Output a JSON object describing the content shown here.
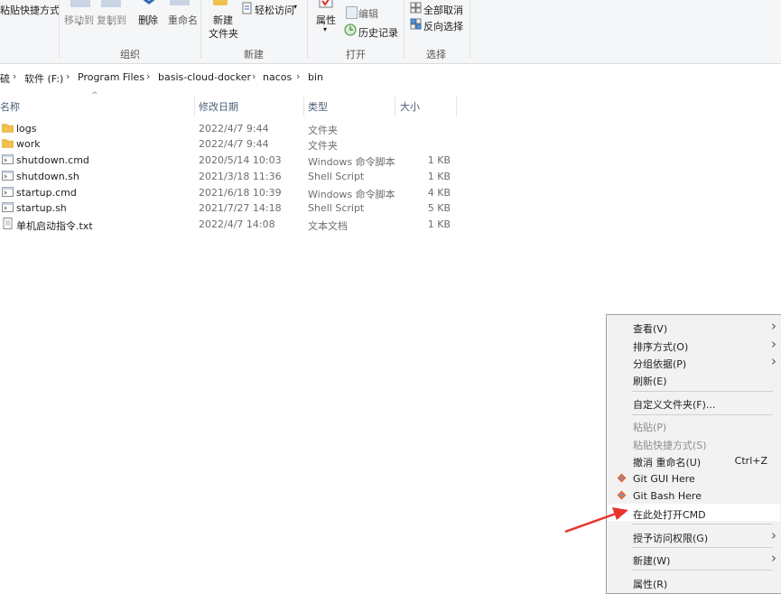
{
  "ribbon": {
    "paste_shortcut": "粘贴快捷方式",
    "move_to": "移动到",
    "copy_to": "复制到",
    "delete": "删除",
    "rename": "重命名",
    "new_folder_1": "新建",
    "new_folder_2": "文件夹",
    "easy_access": "轻松访问",
    "properties": "属性",
    "edit": "编辑",
    "history": "历史记录",
    "select_all": "全部取消",
    "invert": "反向选择",
    "groups": {
      "organize": "组织",
      "new": "新建",
      "open": "打开",
      "select": "选择"
    }
  },
  "breadcrumb": [
    "硫",
    "软件 (F:)",
    "Program Files",
    "basis-cloud-docker",
    "nacos",
    "bin"
  ],
  "columns": {
    "name": "名称",
    "modified": "修改日期",
    "type": "类型",
    "size": "大小"
  },
  "files": [
    {
      "name": "logs",
      "date": "2022/4/7 9:44",
      "type": "文件夹",
      "size": "",
      "icon": "folder-icon"
    },
    {
      "name": "work",
      "date": "2022/4/7 9:44",
      "type": "文件夹",
      "size": "",
      "icon": "folder-icon"
    },
    {
      "name": "shutdown.cmd",
      "date": "2020/5/14 10:03",
      "type": "Windows 命令脚本",
      "size": "1 KB",
      "icon": "script-icon"
    },
    {
      "name": "shutdown.sh",
      "date": "2021/3/18 11:36",
      "type": "Shell Script",
      "size": "1 KB",
      "icon": "script-icon"
    },
    {
      "name": "startup.cmd",
      "date": "2021/6/18 10:39",
      "type": "Windows 命令脚本",
      "size": "4 KB",
      "icon": "script-icon"
    },
    {
      "name": "startup.sh",
      "date": "2021/7/27 14:18",
      "type": "Shell Script",
      "size": "5 KB",
      "icon": "script-icon"
    },
    {
      "name": "单机启动指令.txt",
      "date": "2022/4/7 14:08",
      "type": "文本文档",
      "size": "1 KB",
      "icon": "text-file-icon"
    }
  ],
  "context_menu": {
    "view": "查看(V)",
    "sort": "排序方式(O)",
    "group": "分组依据(P)",
    "refresh": "刷新(E)",
    "customize": "自定义文件夹(F)...",
    "paste": "粘贴(P)",
    "paste_shortcut": "粘贴快捷方式(S)",
    "undo": "撤消 重命名(U)",
    "undo_shortcut": "Ctrl+Z",
    "git_gui": "Git GUI Here",
    "git_bash": "Git Bash Here",
    "open_cmd": "在此处打开CMD",
    "grant_access": "授予访问权限(G)",
    "new": "新建(W)",
    "properties": "属性(R)"
  },
  "colors": {
    "folder": "#f0c14b",
    "arrow": "#e8322b",
    "highlight": "#ffffff",
    "menu_bg": "#f2f2f2"
  }
}
